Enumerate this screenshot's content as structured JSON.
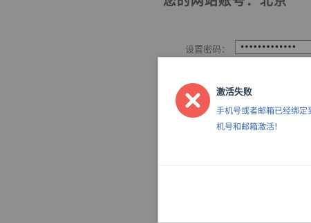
{
  "background": {
    "heading": "您的网站账号：北京",
    "password_label": "设置密码：",
    "password_value": "•••••••••••••"
  },
  "modal": {
    "title": "激活失败",
    "message_line1": "手机号或者邮箱已经绑定到",
    "message_line2": "机号和邮箱激活!",
    "icon": "error-x-circle-icon",
    "icon_color": "#ef5d55"
  }
}
